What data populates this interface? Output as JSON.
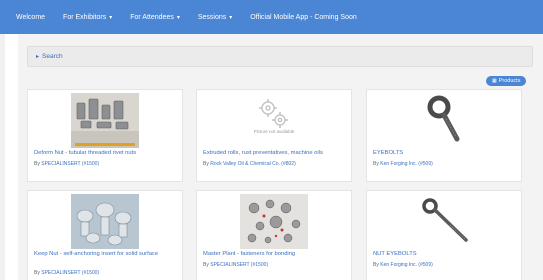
{
  "nav": {
    "items": [
      {
        "label": "Welcome",
        "dropdown": false
      },
      {
        "label": "For Exhibitors",
        "dropdown": true
      },
      {
        "label": "For Attendees",
        "dropdown": true
      },
      {
        "label": "Sessions",
        "dropdown": true
      },
      {
        "label": "Official Mobile App - Coming Soon",
        "dropdown": false
      }
    ],
    "chevron": "▾"
  },
  "search": {
    "label": "Search",
    "chevron": "▸"
  },
  "products_badge": {
    "label": "Products"
  },
  "cards": [
    {
      "title": "Deform Nut - tubular threaded rivet nuts",
      "by": "By",
      "company": "SPECIALINSERT (#1500)"
    },
    {
      "title": "Extruded rolls, rust preventatives, machine oils",
      "by": "By",
      "company": "Rock Valley Oil & Chemical Co. (#802)",
      "noimg": "Picture not available"
    },
    {
      "title": "EYEBOLTS",
      "by": "By",
      "company": "Ken Forging Inc. (#509)"
    },
    {
      "title": "Keep Nut - self-anchoring insert for solid surface",
      "by": "By",
      "company": "SPECIALINSERT (#1500)"
    },
    {
      "title": "Master Plant - fasteners for bonding",
      "by": "By",
      "company": "SPECIALINSERT (#1500)"
    },
    {
      "title": "NUT EYEBOLTS",
      "by": "By",
      "company": "Ken Forging Inc. (#509)"
    }
  ],
  "colors": {
    "accent": "#4a86d4",
    "link": "#3a6fc0"
  }
}
